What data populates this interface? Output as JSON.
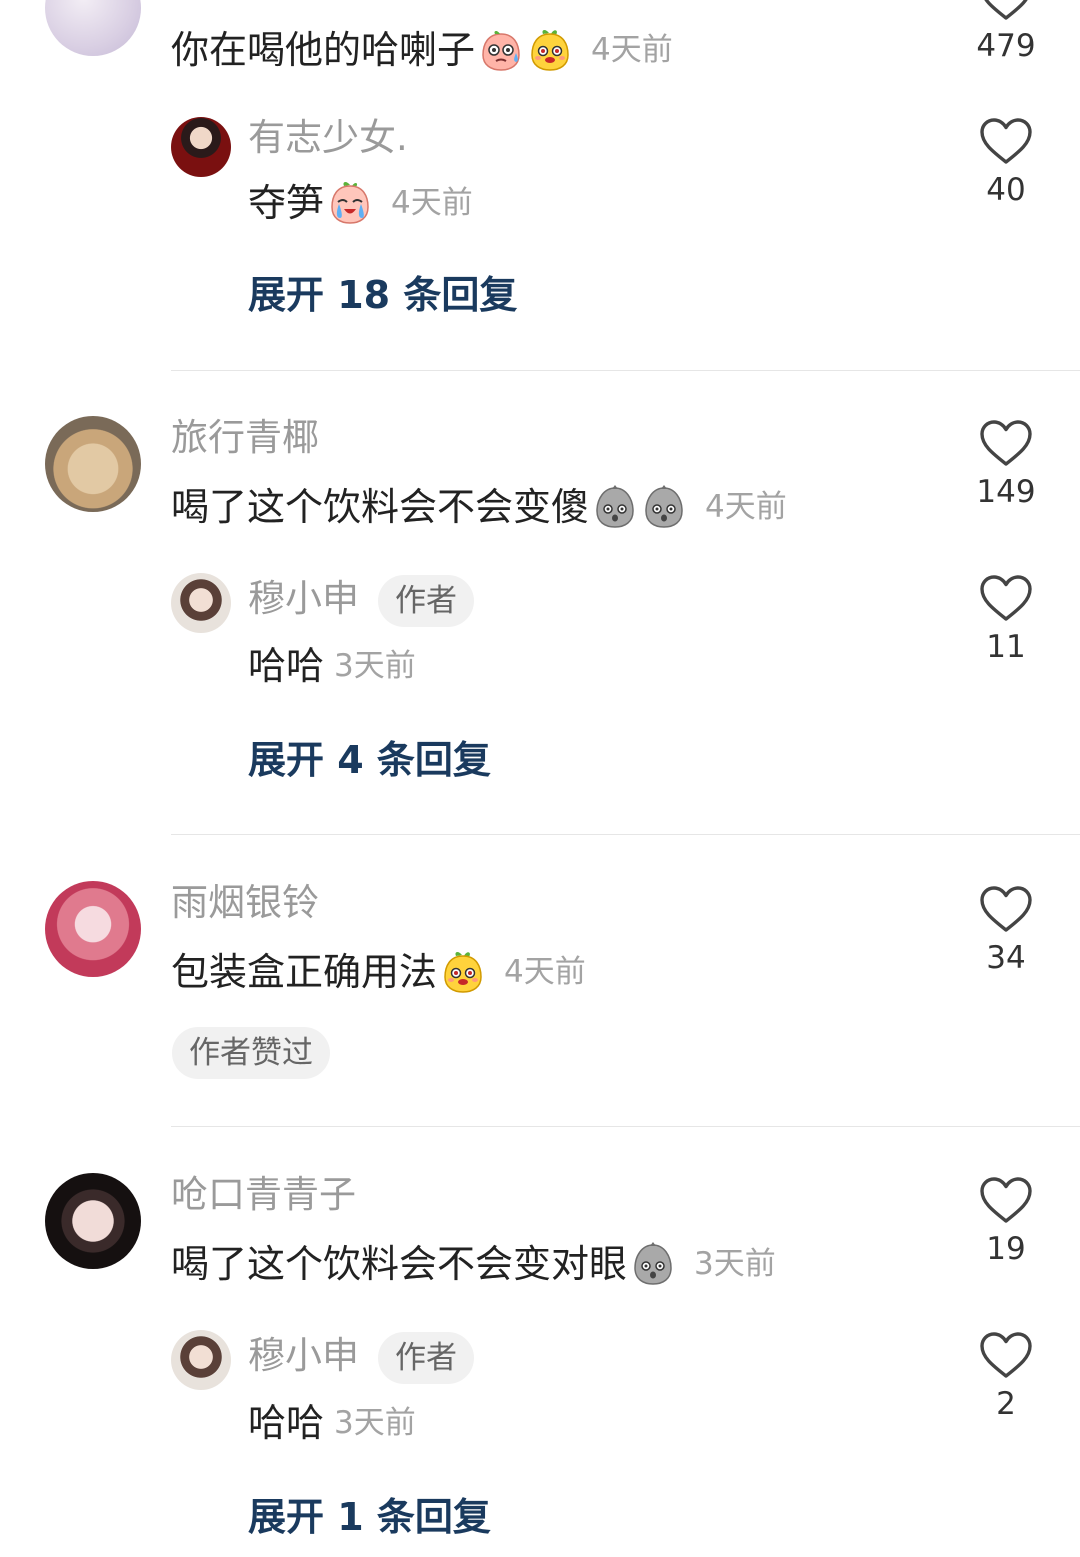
{
  "comments": [
    {
      "name": "",
      "text": "你在喝他的哈喇子",
      "emojis": [
        "sweat-face",
        "yellow-face"
      ],
      "time": "4天前",
      "likes": "479",
      "replies": [
        {
          "name": "有志少女.",
          "text": "夺笋",
          "emojis": [
            "cry-face"
          ],
          "time": "4天前",
          "likes": "40",
          "author_badge": ""
        }
      ],
      "expand": "展开 18 条回复"
    },
    {
      "name": "旅行青椰",
      "text": "喝了这个饮料会不会变傻",
      "emojis": [
        "gray-face",
        "gray-face"
      ],
      "time": "4天前",
      "likes": "149",
      "replies": [
        {
          "name": "穆小申",
          "author_badge": "作者",
          "text": "哈哈",
          "time": "3天前",
          "likes": "11"
        }
      ],
      "expand": "展开 4 条回复"
    },
    {
      "name": "雨烟银铃",
      "text": "包装盒正确用法",
      "emojis": [
        "yellow-face"
      ],
      "time": "4天前",
      "likes": "34",
      "liked_badge": "作者赞过"
    },
    {
      "name": "呛口青青子",
      "text": "喝了这个饮料会不会变对眼",
      "emojis": [
        "gray-face"
      ],
      "time": "3天前",
      "likes": "19",
      "replies": [
        {
          "name": "穆小申",
          "author_badge": "作者",
          "text": "哈哈",
          "time": "3天前",
          "likes": "2"
        }
      ],
      "expand": "展开 1 条回复"
    }
  ]
}
